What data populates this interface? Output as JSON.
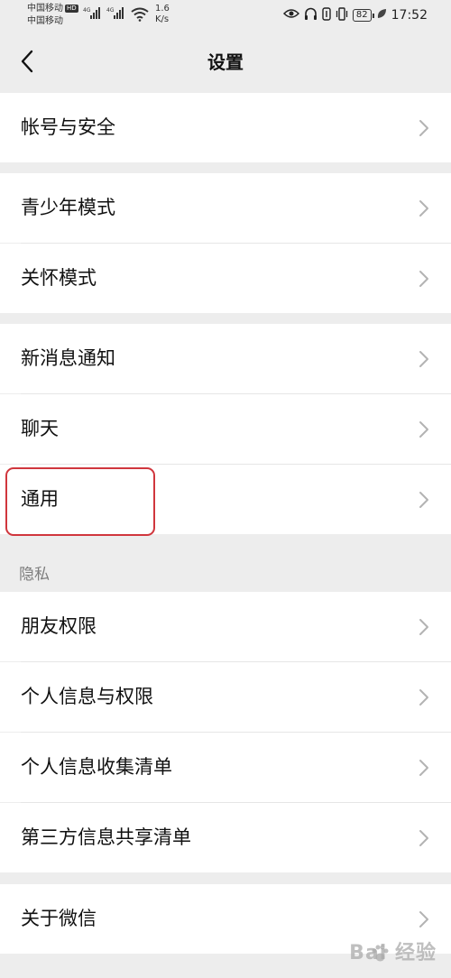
{
  "status_bar": {
    "carrier1": "中国移动",
    "hd": "HD",
    "carrier2": "中国移动",
    "net1": "4G",
    "net2": "4G",
    "speed_value": "1.6",
    "speed_unit": "K/s",
    "battery": "82",
    "time": "17:52"
  },
  "nav": {
    "title": "设置"
  },
  "rows": {
    "account": "帐号与安全",
    "youth": "青少年模式",
    "care": "关怀模式",
    "notify": "新消息通知",
    "chat": "聊天",
    "general": "通用",
    "friends_permission": "朋友权限",
    "personal_info": "个人信息与权限",
    "info_collection": "个人信息收集清单",
    "third_party": "第三方信息共享清单",
    "about": "关于微信"
  },
  "sections": {
    "privacy": "隐私"
  },
  "watermark": {
    "text": "Bai 经验"
  },
  "colors": {
    "background": "#ededed",
    "row": "#ffffff",
    "highlight": "#d0363d"
  }
}
